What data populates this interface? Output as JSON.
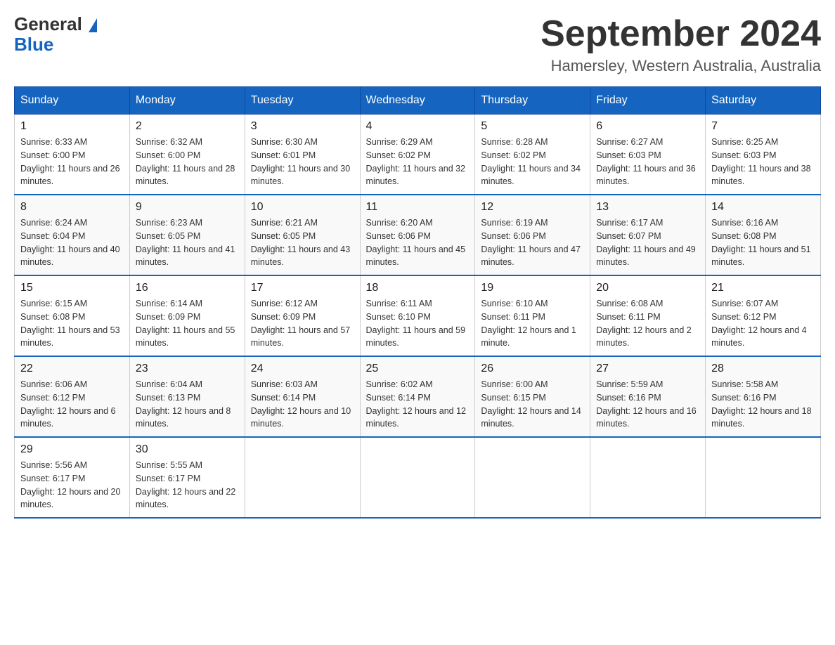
{
  "header": {
    "logo_general": "General",
    "logo_blue": "Blue",
    "month_title": "September 2024",
    "location": "Hamersley, Western Australia, Australia"
  },
  "weekdays": [
    "Sunday",
    "Monday",
    "Tuesday",
    "Wednesday",
    "Thursday",
    "Friday",
    "Saturday"
  ],
  "weeks": [
    [
      {
        "day": "1",
        "sunrise": "6:33 AM",
        "sunset": "6:00 PM",
        "daylight": "11 hours and 26 minutes."
      },
      {
        "day": "2",
        "sunrise": "6:32 AM",
        "sunset": "6:00 PM",
        "daylight": "11 hours and 28 minutes."
      },
      {
        "day": "3",
        "sunrise": "6:30 AM",
        "sunset": "6:01 PM",
        "daylight": "11 hours and 30 minutes."
      },
      {
        "day": "4",
        "sunrise": "6:29 AM",
        "sunset": "6:02 PM",
        "daylight": "11 hours and 32 minutes."
      },
      {
        "day": "5",
        "sunrise": "6:28 AM",
        "sunset": "6:02 PM",
        "daylight": "11 hours and 34 minutes."
      },
      {
        "day": "6",
        "sunrise": "6:27 AM",
        "sunset": "6:03 PM",
        "daylight": "11 hours and 36 minutes."
      },
      {
        "day": "7",
        "sunrise": "6:25 AM",
        "sunset": "6:03 PM",
        "daylight": "11 hours and 38 minutes."
      }
    ],
    [
      {
        "day": "8",
        "sunrise": "6:24 AM",
        "sunset": "6:04 PM",
        "daylight": "11 hours and 40 minutes."
      },
      {
        "day": "9",
        "sunrise": "6:23 AM",
        "sunset": "6:05 PM",
        "daylight": "11 hours and 41 minutes."
      },
      {
        "day": "10",
        "sunrise": "6:21 AM",
        "sunset": "6:05 PM",
        "daylight": "11 hours and 43 minutes."
      },
      {
        "day": "11",
        "sunrise": "6:20 AM",
        "sunset": "6:06 PM",
        "daylight": "11 hours and 45 minutes."
      },
      {
        "day": "12",
        "sunrise": "6:19 AM",
        "sunset": "6:06 PM",
        "daylight": "11 hours and 47 minutes."
      },
      {
        "day": "13",
        "sunrise": "6:17 AM",
        "sunset": "6:07 PM",
        "daylight": "11 hours and 49 minutes."
      },
      {
        "day": "14",
        "sunrise": "6:16 AM",
        "sunset": "6:08 PM",
        "daylight": "11 hours and 51 minutes."
      }
    ],
    [
      {
        "day": "15",
        "sunrise": "6:15 AM",
        "sunset": "6:08 PM",
        "daylight": "11 hours and 53 minutes."
      },
      {
        "day": "16",
        "sunrise": "6:14 AM",
        "sunset": "6:09 PM",
        "daylight": "11 hours and 55 minutes."
      },
      {
        "day": "17",
        "sunrise": "6:12 AM",
        "sunset": "6:09 PM",
        "daylight": "11 hours and 57 minutes."
      },
      {
        "day": "18",
        "sunrise": "6:11 AM",
        "sunset": "6:10 PM",
        "daylight": "11 hours and 59 minutes."
      },
      {
        "day": "19",
        "sunrise": "6:10 AM",
        "sunset": "6:11 PM",
        "daylight": "12 hours and 1 minute."
      },
      {
        "day": "20",
        "sunrise": "6:08 AM",
        "sunset": "6:11 PM",
        "daylight": "12 hours and 2 minutes."
      },
      {
        "day": "21",
        "sunrise": "6:07 AM",
        "sunset": "6:12 PM",
        "daylight": "12 hours and 4 minutes."
      }
    ],
    [
      {
        "day": "22",
        "sunrise": "6:06 AM",
        "sunset": "6:12 PM",
        "daylight": "12 hours and 6 minutes."
      },
      {
        "day": "23",
        "sunrise": "6:04 AM",
        "sunset": "6:13 PM",
        "daylight": "12 hours and 8 minutes."
      },
      {
        "day": "24",
        "sunrise": "6:03 AM",
        "sunset": "6:14 PM",
        "daylight": "12 hours and 10 minutes."
      },
      {
        "day": "25",
        "sunrise": "6:02 AM",
        "sunset": "6:14 PM",
        "daylight": "12 hours and 12 minutes."
      },
      {
        "day": "26",
        "sunrise": "6:00 AM",
        "sunset": "6:15 PM",
        "daylight": "12 hours and 14 minutes."
      },
      {
        "day": "27",
        "sunrise": "5:59 AM",
        "sunset": "6:16 PM",
        "daylight": "12 hours and 16 minutes."
      },
      {
        "day": "28",
        "sunrise": "5:58 AM",
        "sunset": "6:16 PM",
        "daylight": "12 hours and 18 minutes."
      }
    ],
    [
      {
        "day": "29",
        "sunrise": "5:56 AM",
        "sunset": "6:17 PM",
        "daylight": "12 hours and 20 minutes."
      },
      {
        "day": "30",
        "sunrise": "5:55 AM",
        "sunset": "6:17 PM",
        "daylight": "12 hours and 22 minutes."
      },
      null,
      null,
      null,
      null,
      null
    ]
  ]
}
